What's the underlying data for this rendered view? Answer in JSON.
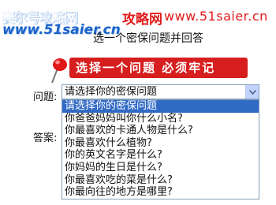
{
  "header": {
    "logo_text": "赛尔号攻略网",
    "site_name": "攻略网",
    "site_url": "www.51saier.cn",
    "watermark": "www.51saier.cn"
  },
  "page_title": "选一个密保问题并回答",
  "callout": {
    "text": "选择一个问题 必须牢记",
    "color": "#d61e1e"
  },
  "form": {
    "question_label": "问题:",
    "answer_label": "答案:",
    "selected_value": "请选择你的密保问题"
  },
  "dropdown": {
    "options": [
      "请选择你的密保问题",
      "你爸爸妈妈叫你什么小名?",
      "你最喜欢的卡通人物是什么?",
      "你最喜欢什么植物?",
      "你的英文名字是什么?",
      "你妈妈的生日是什么?",
      "你最喜欢吃的菜是什么?",
      "你最向往的地方是哪里?"
    ],
    "highlight_color": "#316ac5"
  },
  "icons": {
    "pin": "pushpin-icon",
    "arrow": "chevron-down-icon"
  }
}
